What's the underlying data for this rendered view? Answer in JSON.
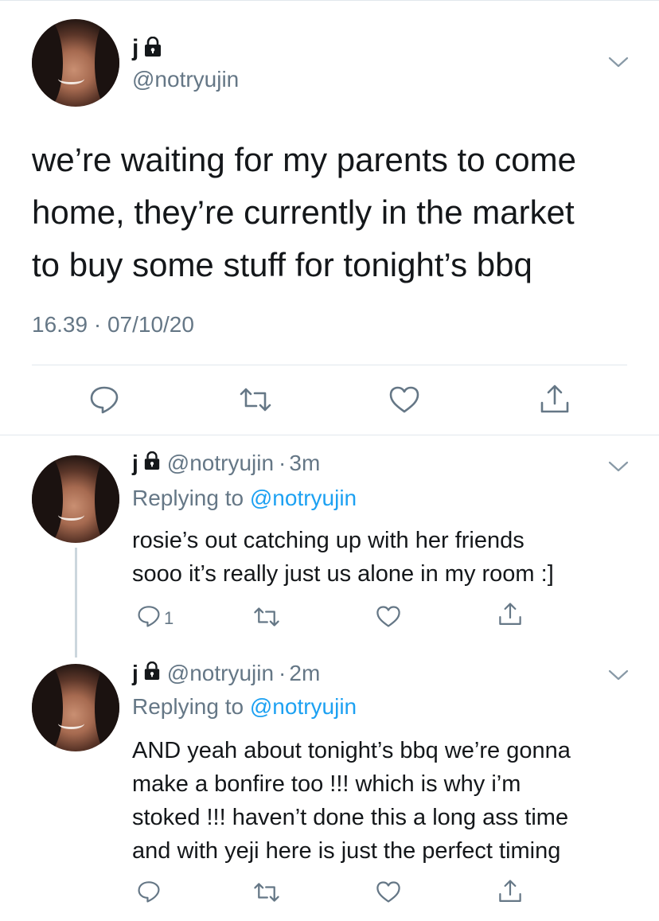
{
  "main_tweet": {
    "name": "j",
    "handle": "@notryujin",
    "text_lines": [
      "we’re waiting for my parents to come",
      "home, they’re currently in the market",
      "to buy some stuff for tonight’s bbq"
    ],
    "timestamp": "16.39 · 07/10/20"
  },
  "replies": [
    {
      "name": "j",
      "handle": "@notryujin",
      "separator": "·",
      "time": "3m",
      "replying_prefix": "Replying to",
      "replying_to": "@notryujin",
      "text_lines": [
        "rosie’s out catching up with her friends",
        "sooo it’s really just us alone in my room :]"
      ],
      "reply_count": "1"
    },
    {
      "name": "j",
      "handle": "@notryujin",
      "separator": "·",
      "time": "2m",
      "replying_prefix": "Replying to",
      "replying_to": "@notryujin",
      "text_lines": [
        "AND yeah about tonight’s bbq we’re gonna",
        "make a bonfire too !!! which is why i’m",
        "stoked !!! haven’t done this a long ass time",
        "and with yeji here is just the perfect timing"
      ],
      "reply_count": ""
    }
  ],
  "icons": {
    "reply": "reply-icon",
    "retweet": "retweet-icon",
    "like": "heart-icon",
    "share": "share-icon",
    "lock": "lock-icon",
    "more": "chevron-down-icon"
  },
  "colors": {
    "text": "#14171a",
    "secondary": "#657786",
    "link": "#1da1f2",
    "divider": "#e1e8ed"
  }
}
